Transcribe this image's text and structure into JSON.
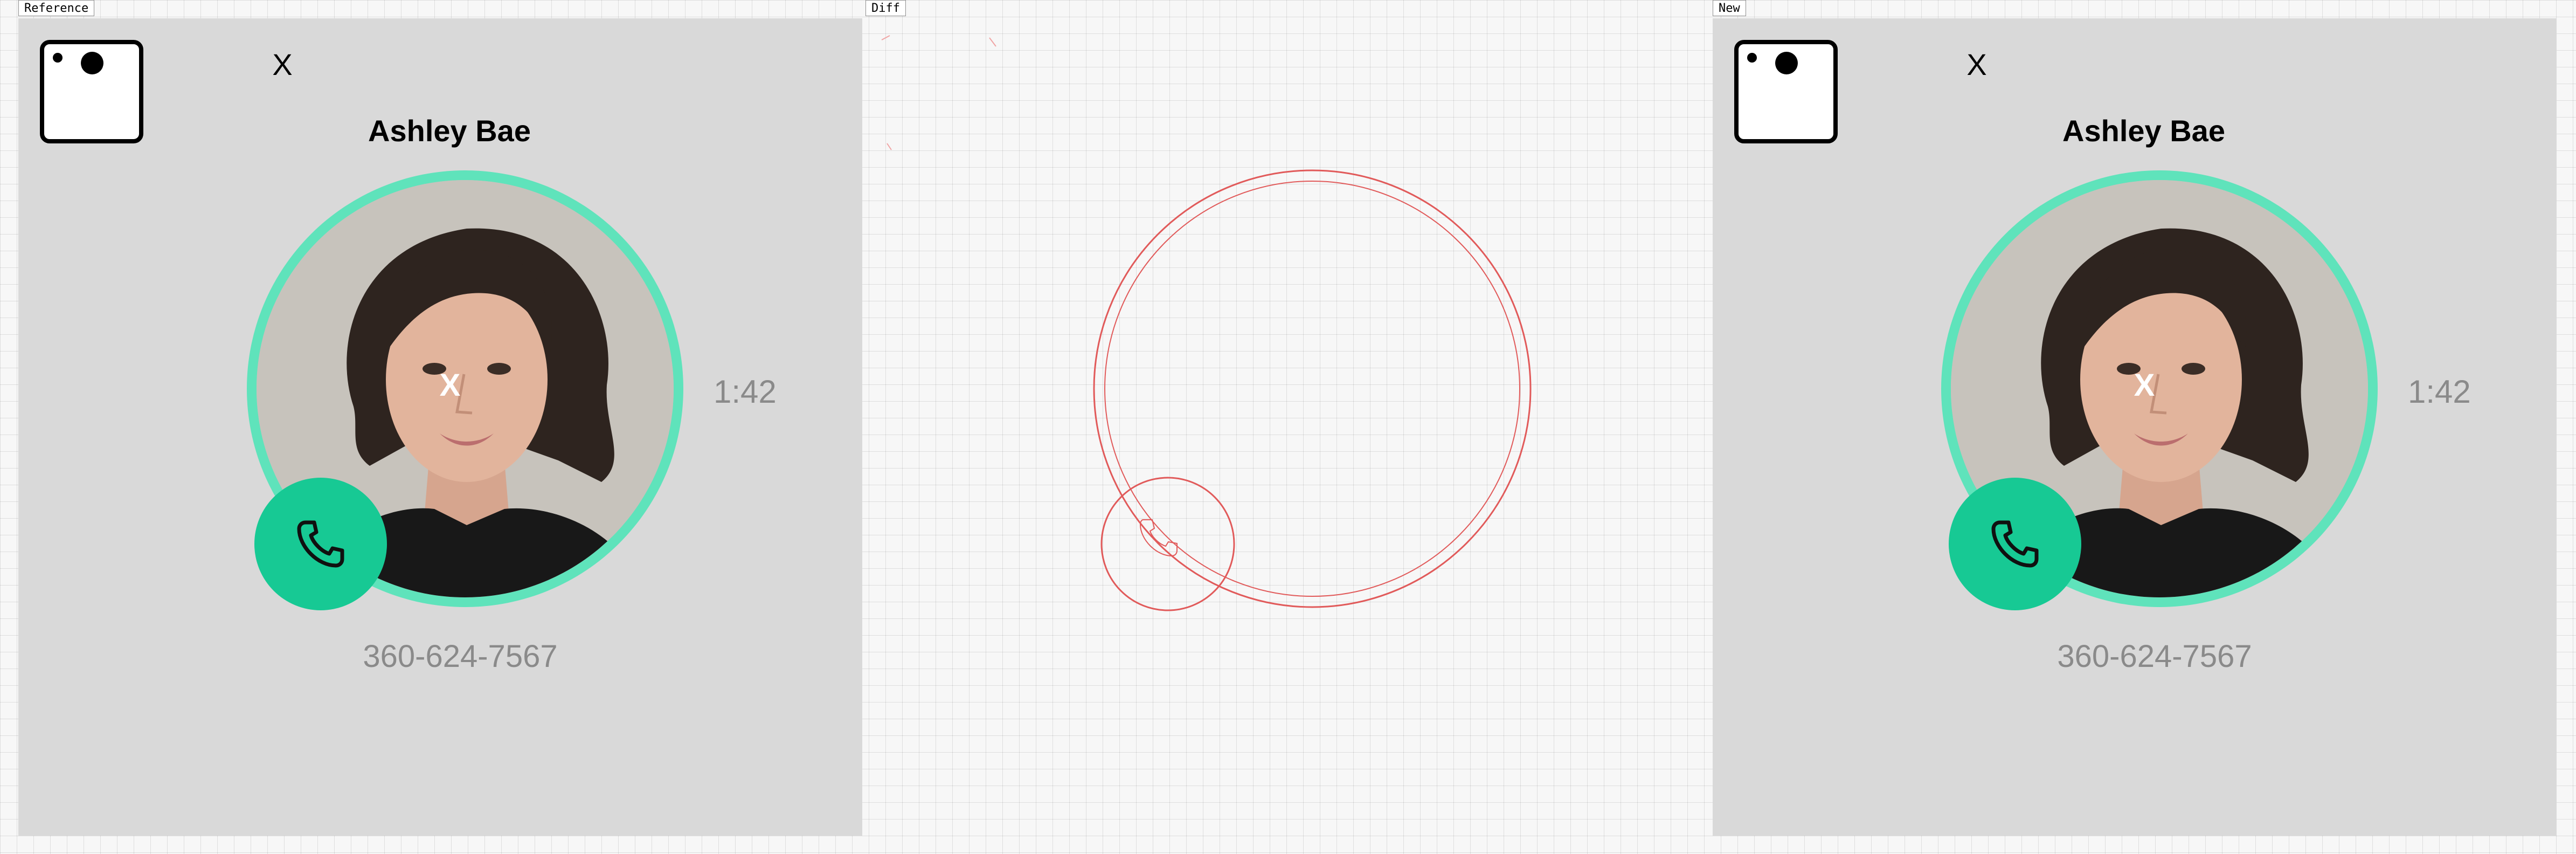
{
  "labels": {
    "reference": "Reference",
    "diff": "Diff",
    "new": "New"
  },
  "contact": {
    "name": "Ashley Bae",
    "phone": "360-624-7567",
    "timer": "1:42"
  },
  "controls": {
    "close_label": "X",
    "face_mark": "X"
  },
  "icons": {
    "app": "app-icon",
    "close": "close-icon",
    "call": "phone-icon"
  },
  "colors": {
    "panel_bg": "#d9d9d9",
    "ring": "#5fe3bb",
    "call_button": "#17c994",
    "timer_text": "#8a8a8a",
    "diff_line": "#e15a5a"
  }
}
